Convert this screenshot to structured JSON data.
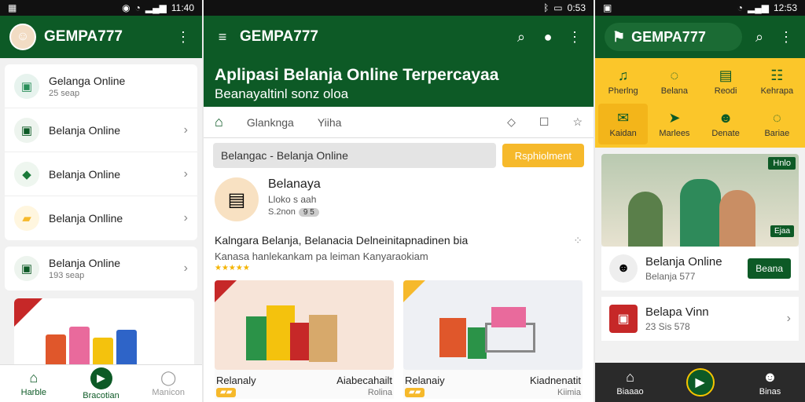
{
  "panel1": {
    "status": {
      "left_icon": "notification-icon",
      "time": "11:40"
    },
    "appbar": {
      "title": "GEMPA777",
      "avatar": "person-avatar"
    },
    "list": [
      {
        "title": "Gelanga Online",
        "sub": "25 seap",
        "icon_color": "#2a8f5a",
        "has_chevron": false
      },
      {
        "title": "Belanja Online",
        "sub": "",
        "icon_color": "#0d5a26",
        "has_chevron": true
      },
      {
        "title": "Belanja Online",
        "sub": "",
        "icon_color": "#1b7a3a",
        "has_chevron": true
      },
      {
        "title": "Belanja Onlline",
        "sub": "",
        "icon_color": "#f6b92b",
        "has_chevron": true
      }
    ],
    "list2": [
      {
        "title": "Belanja Online",
        "sub": "193 seap",
        "icon_color": "#0d5a26",
        "has_chevron": true
      }
    ],
    "bottomnav": [
      {
        "label": "Harble",
        "icon": "home-icon"
      },
      {
        "label": "Bracotian",
        "icon": "play-icon"
      },
      {
        "label": "Manicon",
        "icon": "profile-icon"
      }
    ]
  },
  "panel2": {
    "status": {
      "time": "0:53"
    },
    "appbar": {
      "title": "GEMPA777"
    },
    "hero": {
      "title": "Aplipasi Belanja Online Terpercayaa",
      "subtitle": "Beanayaltinl sonz oloa"
    },
    "tabs": [
      {
        "label": "Glanknga",
        "icon": ""
      },
      {
        "label": "Yiiha",
        "icon": ""
      }
    ],
    "search": {
      "value": "Belangac - Belanja Online",
      "button": "Rsphiolment"
    },
    "shop": {
      "name": "Belanaya",
      "sub": "Lloko s aah",
      "stat": "S.2non",
      "badge": "9 5"
    },
    "desc": "Kalngara Belanja, Belanacia Delneinitapnadinen bia",
    "desc2": "Kanasa hanlekankam pa leiman Kanyaraokiam",
    "cards": [
      {
        "label_left": "Relanaly",
        "label_right": "Aiabecahailt",
        "price_left": "",
        "price_right": "Rolina"
      },
      {
        "label_left": "Relanaiy",
        "label_right": "Kiadnenatit",
        "price_left": "",
        "price_right": "Kiimia"
      }
    ]
  },
  "panel3": {
    "status": {
      "time": "12:53"
    },
    "appbar": {
      "title": "GEMPA777"
    },
    "grid": [
      {
        "label": "Pherlng",
        "icon": "headset-icon"
      },
      {
        "label": "Belana",
        "icon": "chat-icon"
      },
      {
        "label": "Reodi",
        "icon": "document-icon"
      },
      {
        "label": "Kehrapa",
        "icon": "list-icon"
      },
      {
        "label": "Kaidan",
        "icon": "cart-icon"
      },
      {
        "label": "Marlees",
        "icon": "plane-icon"
      },
      {
        "label": "Denate",
        "icon": "users-icon"
      },
      {
        "label": "Bariae",
        "icon": "chat-icon"
      }
    ],
    "banner": {
      "badge": "Hnlo",
      "badge2": "Ejaa"
    },
    "card1": {
      "title": "Belanja Online",
      "sub": "Belanja 577",
      "button": "Beana"
    },
    "card2": {
      "title": "Belapa Vinn",
      "sub": "23 Sis 578"
    },
    "bottomnav": [
      {
        "label": "Biaaao",
        "icon": "home-icon"
      },
      {
        "label": "",
        "icon": "play-icon"
      },
      {
        "label": "Binas",
        "icon": "profile-icon"
      }
    ]
  }
}
